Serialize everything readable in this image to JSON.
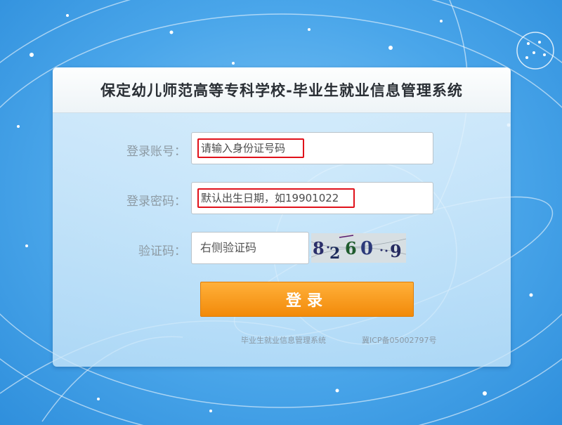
{
  "header": {
    "title": "保定幼儿师范高等专科学校-毕业生就业信息管理系统"
  },
  "form": {
    "account": {
      "label": "登录账号：",
      "placeholder": "请输入身份证号码"
    },
    "password": {
      "label": "登录密码：",
      "placeholder": "默认出生日期，如19901022"
    },
    "captcha": {
      "label": "验证码：",
      "placeholder": "右侧验证码",
      "image_text": "82609"
    }
  },
  "login_button": {
    "label": "登录"
  },
  "footer": {
    "system_name": "毕业生就业信息管理系统",
    "icp": "冀ICP备05002797号"
  },
  "colors": {
    "accent": "#f59a1b",
    "highlight_box": "#e0111a",
    "background": "#4aa6ea"
  }
}
